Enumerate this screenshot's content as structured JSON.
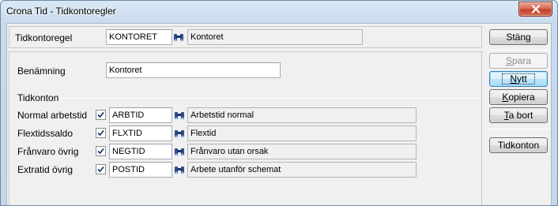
{
  "window": {
    "title": "Crona Tid - Tidkontoregler"
  },
  "header": {
    "label": "Tidkontoregel",
    "code": "KONTORET",
    "name": "Kontoret"
  },
  "form": {
    "benamning_label": "Benämning",
    "benamning_value": "Kontoret",
    "group_label": "Tidkonton",
    "rows": [
      {
        "label": "Normal arbetstid",
        "checked": true,
        "code": "ARBTID",
        "desc": "Arbetstid normal"
      },
      {
        "label": "Flextidssaldo",
        "checked": true,
        "code": "FLXTID",
        "desc": "Flextid"
      },
      {
        "label": "Frånvaro övrig",
        "checked": true,
        "code": "NEGTID",
        "desc": "Frånvaro utan orsak"
      },
      {
        "label": "Extratid övrig",
        "checked": true,
        "code": "POSTID",
        "desc": "Arbete utanför schemat"
      }
    ]
  },
  "buttons": {
    "stang": "Stäng",
    "spara_first": "S",
    "spara_rest": "para",
    "nytt_first": "N",
    "nytt_rest": "ytt",
    "kopiera_first": "K",
    "kopiera_rest": "opiera",
    "tabort_first": "T",
    "tabort_rest": "a bort",
    "tidkonton": "Tidkonton"
  },
  "icons": {
    "lookup": "binoculars-icon",
    "check": "checkmark-icon",
    "close": "close-icon"
  },
  "colors": {
    "titlebar": "#c8daee",
    "close_button": "#c2412a",
    "default_button_border": "#3c7fb1"
  }
}
